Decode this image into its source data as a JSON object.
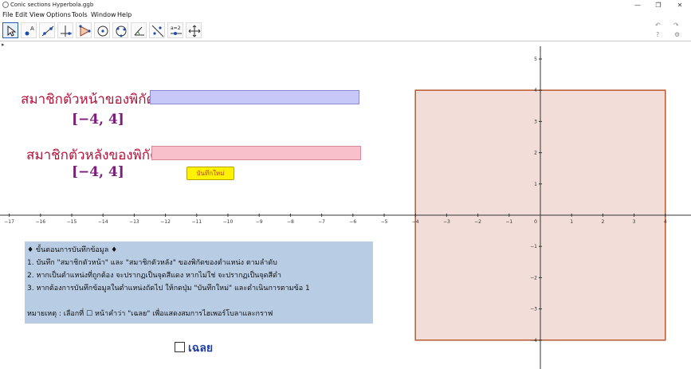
{
  "window": {
    "title": "Conic sections Hyperbola.ggb",
    "controls": {
      "minimize": "—",
      "maximize": "❐",
      "close": "✕"
    }
  },
  "menu": {
    "items": [
      "File",
      "Edit",
      "View",
      "Options",
      "Tools",
      "Window",
      "Help"
    ]
  },
  "toolbar": {
    "tools": [
      "move-tool",
      "point-tool",
      "line-tool",
      "perpendicular-tool",
      "polygon-tool",
      "circle-tool",
      "conic-tool",
      "angle-tool",
      "reflect-tool",
      "slider-tool",
      "move-view-tool"
    ],
    "slider_tool_label": "a=2",
    "undo": "↶",
    "redo": "↷",
    "help": "?",
    "settings": "⚙"
  },
  "stylebar_toggle": "▸",
  "graphics": {
    "slider1_label": "สมาชิกตัวหน้าของพิกัด",
    "slider1_range": "[−4, 4]",
    "slider2_label": "สมาชิกตัวหลังของพิกัด",
    "slider2_range": "[−4, 4]",
    "save_button": "บันทึกใหม่",
    "accent_colors": {
      "label": "#b5123a",
      "rect_fill": "#f2ddd8",
      "rect_stroke": "#b85a2e"
    },
    "info": {
      "line1": "♦ ขั้นตอนการบันทึกข้อมูล ♦",
      "line2": "1. บันทึก \"สมาชิกตัวหน้า\" และ \"สมาชิกตัวหลัง\" ของพิกัดของตำแหน่ง ตามลำดับ",
      "line3": "2. หากเป็นตำแหน่งที่ถูกต้อง จะปรากฏเป็นจุดสีแดง  หากไม่ใช่ จะปรากฏเป็นจุดสีดำ",
      "line4": "3. หากต้องการบันทึกข้อมูลในตำแหน่งถัดไป ให้กดปุ่ม \"บันทึกใหม่\" และดำเนินการตามข้อ 1",
      "note": "หมายเหตุ : เลือกที่ ☐ หน้าคำว่า \"เฉลย\" เพื่อแสดงสมการไฮเพอร์โบลาและกราฟ"
    },
    "answer_checkbox": "เฉลย",
    "axes": {
      "x_ticks": [
        -17,
        -16,
        -15,
        -14,
        -13,
        -12,
        -11,
        -10,
        -9,
        -8,
        -7,
        -6,
        -5,
        -4,
        -3,
        -2,
        -1,
        0,
        1,
        2,
        3,
        4
      ],
      "y_ticks": [
        -4,
        -3,
        -2,
        -1,
        1,
        2,
        3,
        4,
        5
      ],
      "square": {
        "xmin": -4,
        "xmax": 4,
        "ymin": -4,
        "ymax": 4
      }
    }
  }
}
